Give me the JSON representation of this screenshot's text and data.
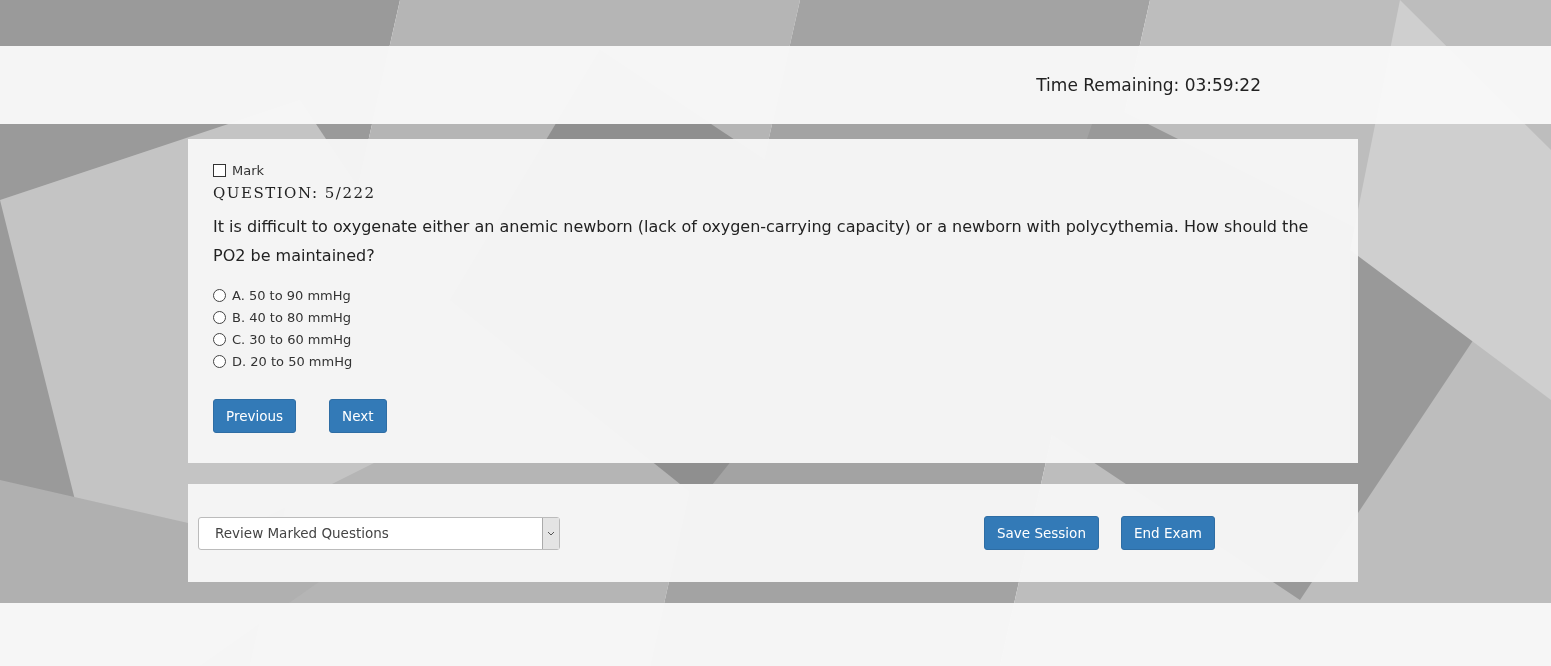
{
  "header": {
    "timer": "Time Remaining: 03:59:22"
  },
  "question": {
    "mark": {
      "label": "Mark",
      "checked": false
    },
    "heading": "QUESTION: 5/222",
    "text": "It is difficult to oxygenate either an anemic newborn (lack of oxygen-carrying capacity) or a newborn with polycythemia. How should the PO2 be maintained?",
    "options": [
      {
        "label": "A. 50 to 90 mmHg",
        "selected": false
      },
      {
        "label": "B. 40 to 80 mmHg",
        "selected": false
      },
      {
        "label": "C. 30 to 60 mmHg",
        "selected": false
      },
      {
        "label": "D. 20 to 50 mmHg",
        "selected": false
      }
    ],
    "buttons": [
      "Previous",
      "Next"
    ]
  },
  "footer": {
    "review_select": "Review Marked Questions",
    "buttons": [
      "Save Session",
      "End Exam"
    ]
  }
}
